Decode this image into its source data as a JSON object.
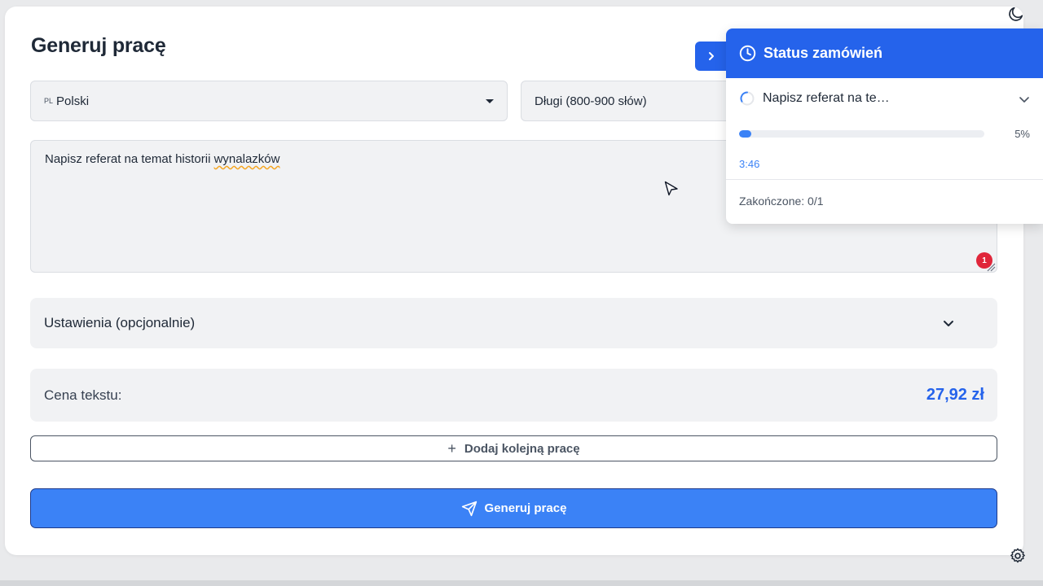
{
  "page": {
    "title": "Generuj pracę"
  },
  "language_select": {
    "code": "PL",
    "value": "Polski"
  },
  "length_select": {
    "value": "Długi (800-900 słów)"
  },
  "prompt": {
    "text_main": "Napisz referat na temat historii ",
    "text_flagged": "wynalazków",
    "error_count": "1"
  },
  "settings": {
    "label": "Ustawienia (opcjonalnie)"
  },
  "price": {
    "label": "Cena tekstu:",
    "value": "27,92 zł"
  },
  "add_button": {
    "label": "Dodaj kolejną pracę"
  },
  "generate_button": {
    "label": "Generuj pracę"
  },
  "status_panel": {
    "title": "Status zamówień",
    "order": {
      "title": "Napisz referat na te…",
      "progress_percent": 5,
      "progress_label": "5%",
      "time": "3:46"
    },
    "completed": "Zakończone: 0/1"
  },
  "colors": {
    "accent": "#2563eb",
    "button": "#3b82f6",
    "error": "#e0263a"
  },
  "icons": [
    "moon-icon",
    "clock-icon",
    "spinner-icon",
    "chevron-down-icon",
    "chevron-right-icon",
    "plus-icon",
    "send-icon",
    "gear-icon"
  ]
}
